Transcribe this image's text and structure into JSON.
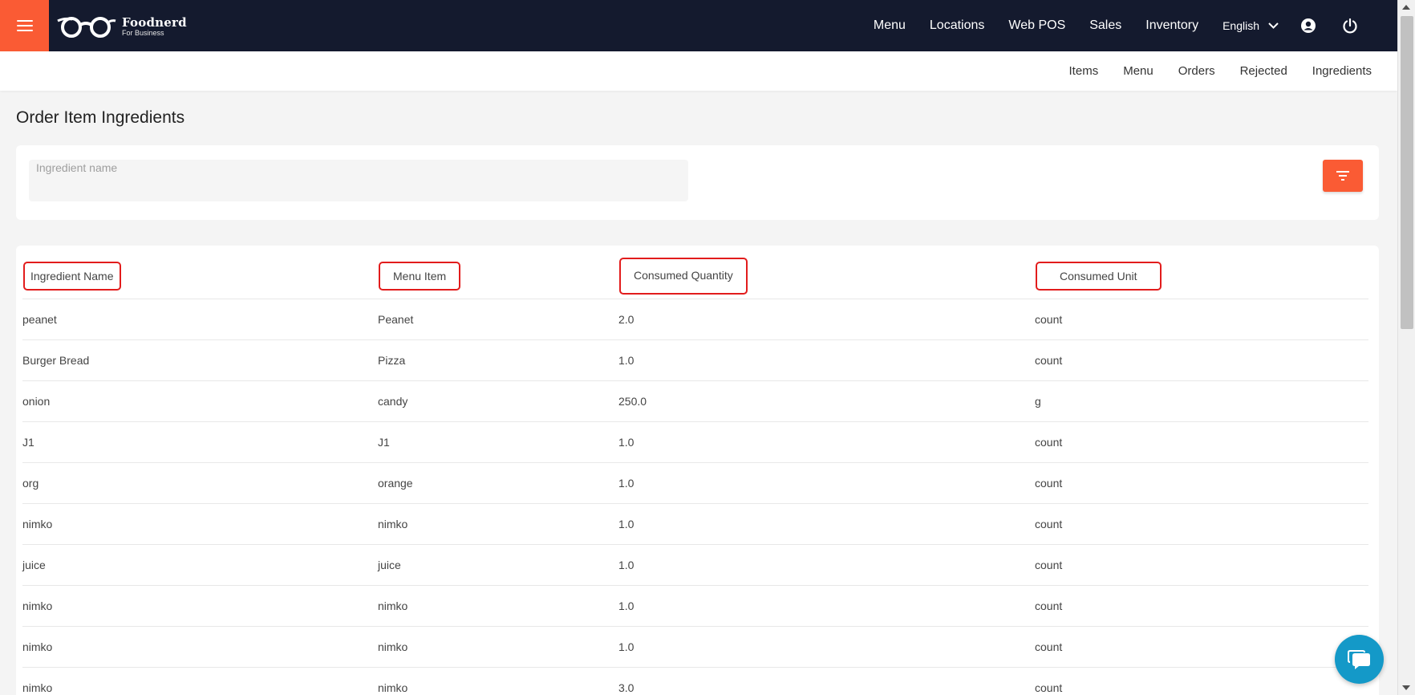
{
  "brand": {
    "name": "Foodnerd",
    "tagline": "For Business"
  },
  "topnav": {
    "items": [
      {
        "label": "Menu"
      },
      {
        "label": "Locations"
      },
      {
        "label": "Web POS"
      },
      {
        "label": "Sales"
      },
      {
        "label": "Inventory"
      }
    ],
    "language": "English"
  },
  "subnav": {
    "items": [
      {
        "label": "Items"
      },
      {
        "label": "Menu"
      },
      {
        "label": "Orders"
      },
      {
        "label": "Rejected"
      },
      {
        "label": "Ingredients"
      }
    ]
  },
  "page": {
    "title": "Order Item Ingredients"
  },
  "search": {
    "label": "Ingredient name",
    "value": ""
  },
  "table": {
    "headers": {
      "ingredient_name": "Ingredient Name",
      "menu_item": "Menu Item",
      "consumed_quantity": "Consumed Quantity",
      "consumed_unit": "Consumed Unit"
    },
    "rows": [
      {
        "ingredient": "peanet",
        "menu_item": "Peanet",
        "quantity": "2.0",
        "unit": "count"
      },
      {
        "ingredient": "Burger Bread",
        "menu_item": "Pizza",
        "quantity": "1.0",
        "unit": "count"
      },
      {
        "ingredient": "onion",
        "menu_item": "candy",
        "quantity": "250.0",
        "unit": "g"
      },
      {
        "ingredient": "J1",
        "menu_item": "J1",
        "quantity": "1.0",
        "unit": "count"
      },
      {
        "ingredient": "org",
        "menu_item": "orange",
        "quantity": "1.0",
        "unit": "count"
      },
      {
        "ingredient": "nimko",
        "menu_item": "nimko",
        "quantity": "1.0",
        "unit": "count"
      },
      {
        "ingredient": "juice",
        "menu_item": "juice",
        "quantity": "1.0",
        "unit": "count"
      },
      {
        "ingredient": "nimko",
        "menu_item": "nimko",
        "quantity": "1.0",
        "unit": "count"
      },
      {
        "ingredient": "nimko",
        "menu_item": "nimko",
        "quantity": "1.0",
        "unit": "count"
      },
      {
        "ingredient": "nimko",
        "menu_item": "nimko",
        "quantity": "3.0",
        "unit": "count"
      }
    ]
  },
  "colors": {
    "accent": "#fa5b34",
    "topbar": "#141a2e",
    "highlight": "#e21c1c",
    "chat": "#1499c8"
  },
  "icons": {
    "menu": "hamburger-menu-icon",
    "logo": "glasses-logo-icon",
    "language": "chevron-down-icon",
    "account": "user-circle-icon",
    "logout": "power-icon",
    "filter": "filter-icon",
    "chat": "chat-bubble-icon"
  }
}
